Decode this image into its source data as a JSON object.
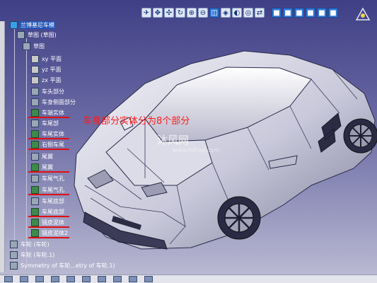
{
  "tree": {
    "root": "兰博基尼车模",
    "sketch_group": "草图 (草图)",
    "sketch": "草图",
    "planes": [
      "xy 平面",
      "yz 平面",
      "zx 平面"
    ],
    "items": [
      "车头部分",
      "车身侧面部分",
      "车端实体",
      "车尾部",
      "车尾实体",
      "右侧车尾",
      "尾翼",
      "尾翼",
      "车尾气孔",
      "车尾气孔",
      "车尾底部",
      "车尾底部",
      "镜皮泥体",
      "镜皮泥体2"
    ],
    "wheels": [
      "车轮 (车轮)",
      "车轮 (车轮.1)"
    ],
    "symmetry": "Symmetry of 车轮...etry of 车轮.1)"
  },
  "annotation": "车身部分实体分为8个部分",
  "watermark": {
    "brand": "沐风网",
    "url": "www.mfcad.com"
  },
  "toolbar": {
    "icons": [
      "fly-icon",
      "fit-all-icon",
      "pan-icon",
      "rotate-icon",
      "zoom-in-icon",
      "zoom-out-icon",
      "normal-view-icon",
      "iso-view-icon",
      "shading-icon",
      "hide-show-icon",
      "swap-icon",
      "cube-view-icons"
    ]
  },
  "colors": {
    "viewport_top": "#3f3f86",
    "viewport_bottom": "#b9b9d2",
    "annotation": "#ff1a1a",
    "highlight": "#2356b8"
  }
}
